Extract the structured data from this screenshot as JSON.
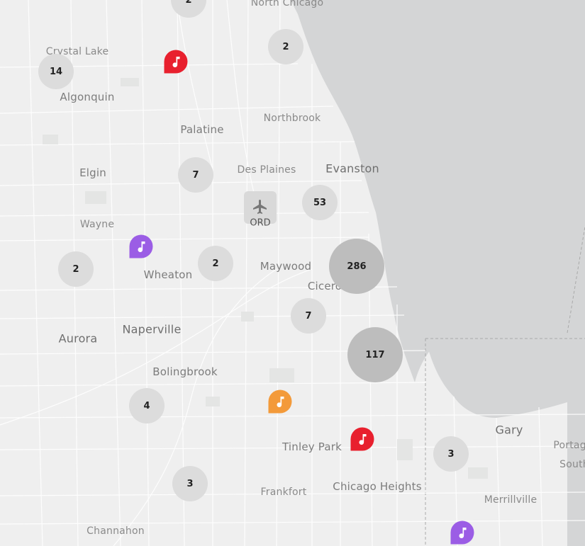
{
  "colors": {
    "water": "#d4d5d6",
    "land": "#efefef",
    "pin_red": "#e8202e",
    "pin_purple": "#9b5de5",
    "pin_orange": "#f39a3a",
    "cluster_small": "#dcdcdc",
    "cluster_large": "#bdbdbd"
  },
  "places": [
    {
      "name": "North Chicago"
    },
    {
      "name": "Crystal Lake"
    },
    {
      "name": "Algonquin"
    },
    {
      "name": "Northbrook"
    },
    {
      "name": "Palatine"
    },
    {
      "name": "Elgin"
    },
    {
      "name": "Des Plaines"
    },
    {
      "name": "Evanston"
    },
    {
      "name": "Wayne"
    },
    {
      "name": "Wheaton"
    },
    {
      "name": "Maywood"
    },
    {
      "name": "Cicero"
    },
    {
      "name": "Aurora"
    },
    {
      "name": "Naperville"
    },
    {
      "name": "Bolingbrook"
    },
    {
      "name": "Tinley Park"
    },
    {
      "name": "Gary"
    },
    {
      "name": "Portage"
    },
    {
      "name": "South"
    },
    {
      "name": "Frankfort"
    },
    {
      "name": "Chicago Heights"
    },
    {
      "name": "Merrillville"
    },
    {
      "name": "Channahon"
    }
  ],
  "airport": {
    "code": "ORD",
    "icon": "airplane-icon"
  },
  "clusters": [
    {
      "count": "2"
    },
    {
      "count": "2"
    },
    {
      "count": "14"
    },
    {
      "count": "7"
    },
    {
      "count": "53"
    },
    {
      "count": "2"
    },
    {
      "count": "2"
    },
    {
      "count": "286"
    },
    {
      "count": "7"
    },
    {
      "count": "117"
    },
    {
      "count": "4"
    },
    {
      "count": "3"
    },
    {
      "count": "3"
    }
  ],
  "pins": [
    {
      "color": "red",
      "icon": "music-note-icon"
    },
    {
      "color": "purple",
      "icon": "music-note-icon"
    },
    {
      "color": "orange",
      "icon": "music-note-icon"
    },
    {
      "color": "red",
      "icon": "music-note-icon"
    },
    {
      "color": "purple",
      "icon": "music-note-icon"
    }
  ]
}
